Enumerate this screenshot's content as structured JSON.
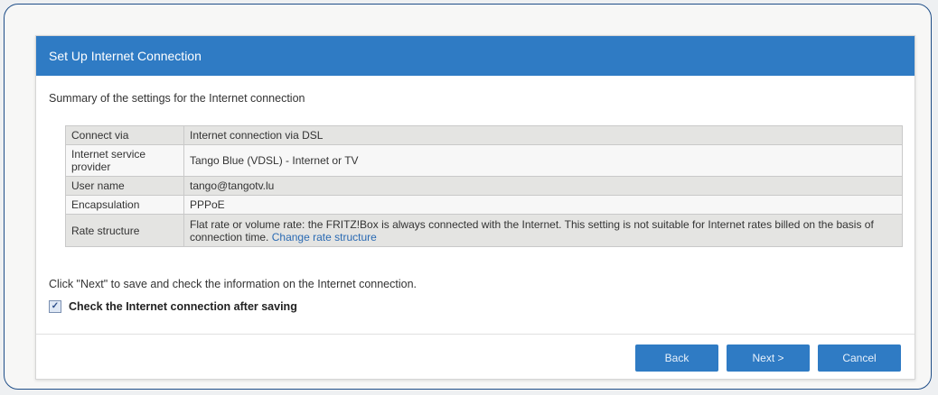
{
  "dialog": {
    "title": "Set Up Internet Connection",
    "summary_heading": "Summary of the settings for the Internet connection",
    "rows": [
      {
        "label": "Connect via",
        "value": "Internet connection via DSL"
      },
      {
        "label": "Internet service provider",
        "value": "Tango Blue (VDSL) - Internet or TV"
      },
      {
        "label": "User name",
        "value": "tango@tangotv.lu"
      },
      {
        "label": "Encapsulation",
        "value": "PPPoE"
      },
      {
        "label": "Rate structure",
        "value": "Flat rate or volume rate: the FRITZ!Box is always connected with the Internet. This setting is not suitable for Internet rates billed on the basis of connection time.",
        "link": "Change rate structure"
      }
    ],
    "note": "Click \"Next\" to save and check the information on the Internet connection.",
    "checkbox": {
      "label": "Check the Internet connection after saving",
      "checked": true
    },
    "buttons": {
      "back": "Back",
      "next": "Next >",
      "cancel": "Cancel"
    }
  },
  "colors": {
    "header": "#2f7bc4",
    "button": "#2f7bc4",
    "link": "#2a6ab3",
    "frame": "#1f4e88"
  }
}
